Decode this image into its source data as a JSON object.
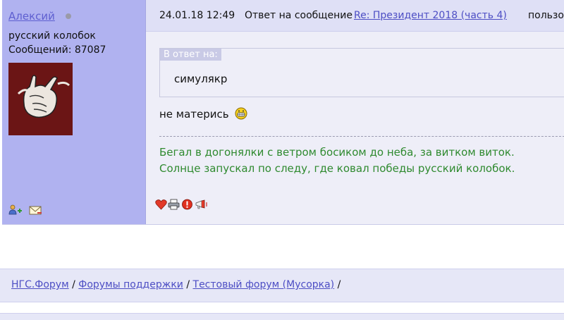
{
  "post": {
    "author": "Алексий",
    "user_title": "русский колобок",
    "post_count": "Сообщений: 87087",
    "date": "24.01.18 12:49",
    "reply_prefix": "Ответ на сообщение",
    "reply_topic": "Re: Президент 2018 (часть 4)",
    "reply_suffix": "пользов",
    "quote_label": "В ответ на:",
    "quote_text": "симулякр",
    "message": "не матерись",
    "signature": [
      "Бегал в догонялки с ветром босиком до неба, за витком виток.",
      "Солнце запускал по следу, где ковал победы русский колобок."
    ],
    "icons": {
      "status": "offline-dot-icon",
      "add_friend": "add-user-icon",
      "send_message": "envelope-icon",
      "smiley": "grin-smiley-icon",
      "like": "heart-icon",
      "print": "printer-icon",
      "report": "warning-icon",
      "complaint": "megaphone-icon"
    }
  },
  "breadcrumb": {
    "items": [
      "НГС.Форум",
      "Форумы поддержки",
      "Тестовый форум (Мусорка)"
    ],
    "separator": "/"
  },
  "colors": {
    "sidebar_bg": "#b0b2f0",
    "post_bg": "#eeeef8",
    "link": "#4d4ec4",
    "signature": "#2f8a2f"
  }
}
